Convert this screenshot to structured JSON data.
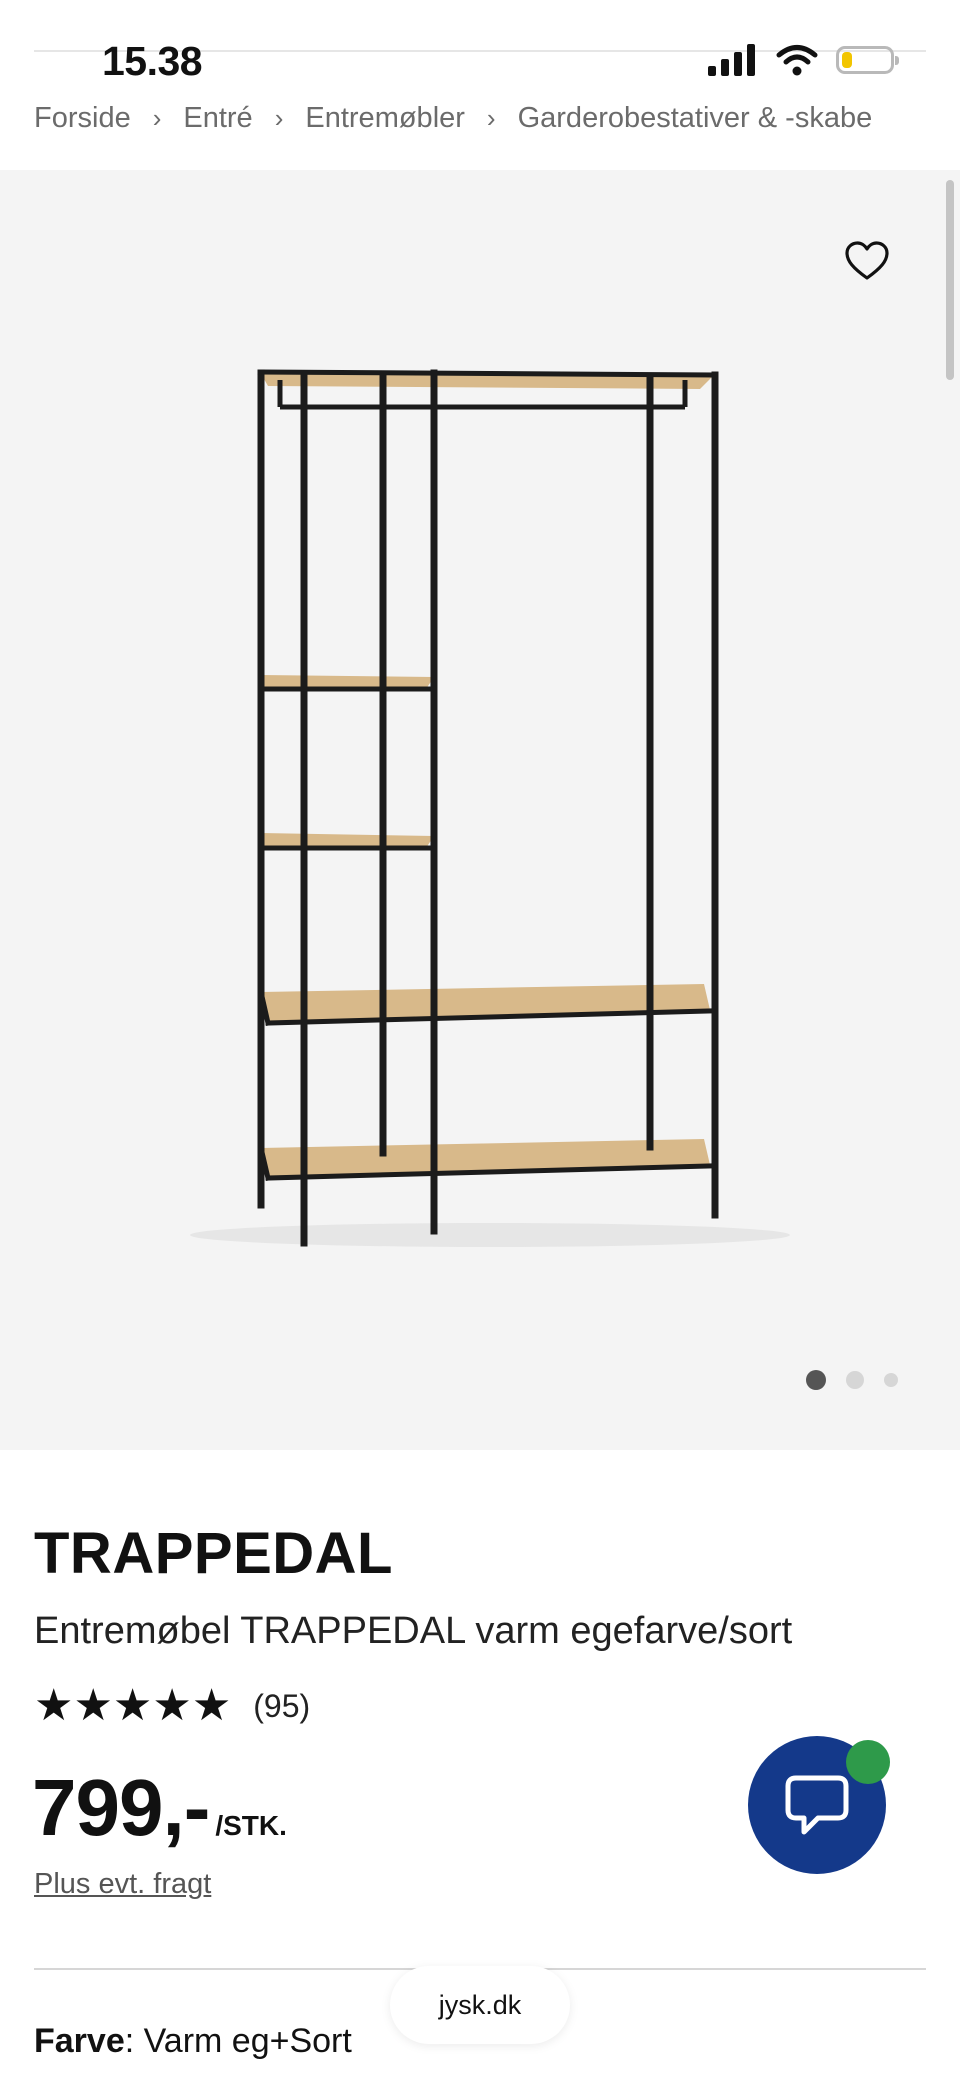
{
  "status": {
    "time": "15.38"
  },
  "breadcrumb": [
    "Forside",
    "Entré",
    "Entremøbler",
    "Garderobestativer & -skabe"
  ],
  "gallery": {
    "image_count": 3,
    "active_index": 0
  },
  "product": {
    "brand": "TRAPPEDAL",
    "name": "Entremøbel TRAPPEDAL varm egefarve/sort",
    "rating": 5,
    "review_count": "(95)",
    "price": "799,-",
    "unit": "/STK.",
    "shipping_note": "Plus evt. fragt",
    "color_label": "Farve",
    "color_value": "Varm eg+Sort"
  },
  "browser": {
    "url": "jysk.dk"
  },
  "colors": {
    "brand_blue": "#14398a",
    "online_green": "#2e9a4a",
    "shelf_wood": "#d8b98a",
    "frame_black": "#1b1b1b"
  }
}
